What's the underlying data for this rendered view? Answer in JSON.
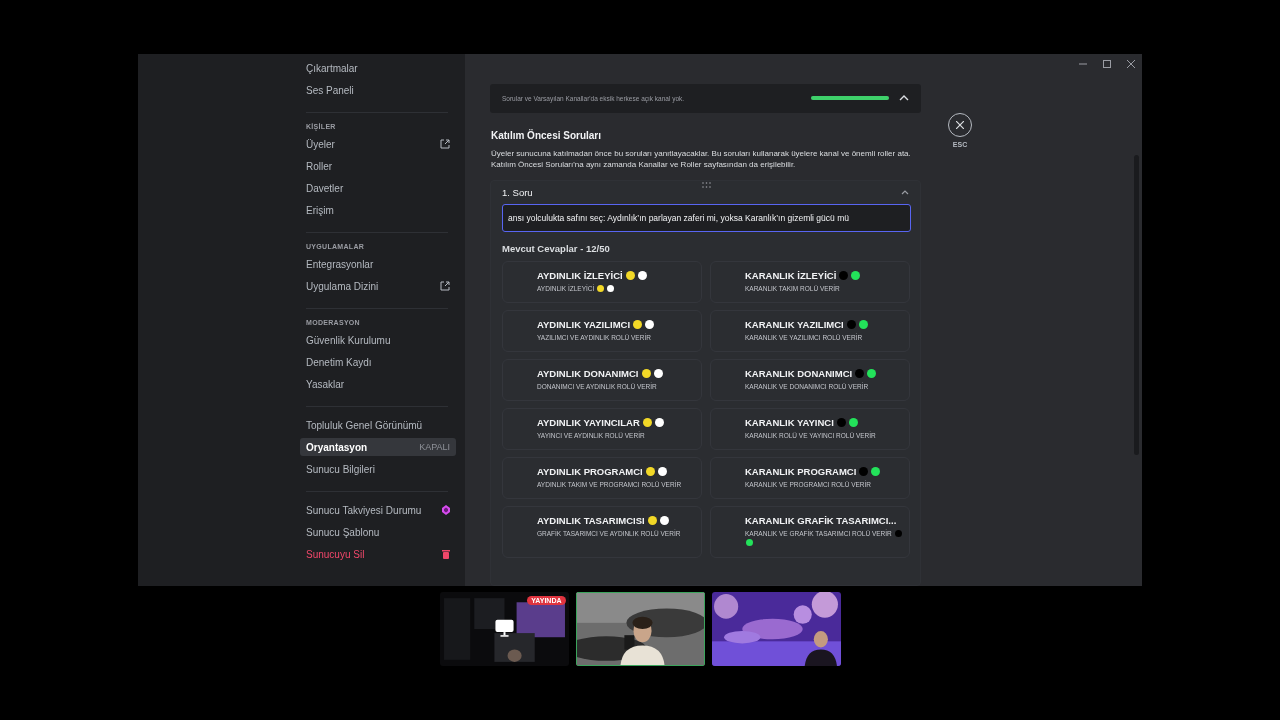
{
  "sidebar": {
    "groups": [
      {
        "items": [
          {
            "label": "Çıkartmalar",
            "selected": false,
            "kind": "plain"
          },
          {
            "label": "Ses Paneli",
            "selected": false,
            "kind": "plain"
          }
        ]
      },
      {
        "header": "KİŞİLER",
        "items": [
          {
            "label": "Üyeler",
            "selected": false,
            "kind": "external"
          },
          {
            "label": "Roller",
            "selected": false,
            "kind": "plain"
          },
          {
            "label": "Davetler",
            "selected": false,
            "kind": "plain"
          },
          {
            "label": "Erişim",
            "selected": false,
            "kind": "plain"
          }
        ]
      },
      {
        "header": "UYGULAMALAR",
        "items": [
          {
            "label": "Entegrasyonlar",
            "selected": false,
            "kind": "plain"
          },
          {
            "label": "Uygulama Dizini",
            "selected": false,
            "kind": "external"
          }
        ]
      },
      {
        "header": "MODERASYON",
        "items": [
          {
            "label": "Güvenlik Kurulumu",
            "selected": false,
            "kind": "plain"
          },
          {
            "label": "Denetim Kaydı",
            "selected": false,
            "kind": "plain"
          },
          {
            "label": "Yasaklar",
            "selected": false,
            "kind": "plain"
          }
        ]
      },
      {
        "items": [
          {
            "label": "Topluluk Genel Görünümü",
            "selected": false,
            "kind": "plain"
          },
          {
            "label": "Oryantasyon",
            "selected": true,
            "kind": "badge",
            "badge": "KAPALI"
          },
          {
            "label": "Sunucu Bilgileri",
            "selected": false,
            "kind": "plain"
          }
        ]
      },
      {
        "items": [
          {
            "label": "Sunucu Takviyesi Durumu",
            "selected": false,
            "kind": "boost"
          },
          {
            "label": "Sunucu Şablonu",
            "selected": false,
            "kind": "plain"
          },
          {
            "label": "Sunucuyu Sil",
            "selected": false,
            "kind": "danger"
          }
        ]
      }
    ]
  },
  "banner": {
    "text": "Sorular ve Varsayılan Kanallar'da eksik herkese açık kanal yok.",
    "level": 1
  },
  "close": {
    "label": "ESC"
  },
  "section": {
    "title": "Katılım Öncesi Soruları",
    "description": "Üyeler sunucuna katılmadan önce bu soruları yanıtlayacaklar. Bu soruları kullanarak üyelere kanal ve önemli roller ata. Katılım Öncesi Soruları'na aynı zamanda Kanallar ve Roller sayfasından da erişilebilir."
  },
  "question": {
    "label": "1. Soru",
    "value": "ansı yolculukta safını seç: Aydınlık’ın parlayan zaferi mi, yoksa Karanlık’ın gizemli gücü mü",
    "expanded": true,
    "answers_title": "Mevcut Cevaplar - 12/50",
    "answers": [
      {
        "title": "AYDINLIK İZLEYİCİ",
        "description": "AYDINLIK İZLEYİCİ",
        "kind": "both",
        "dots": [
          {
            "color": "#f2d827"
          },
          {
            "color": "#ffffff"
          }
        ]
      },
      {
        "title": "KARANLIK İZLEYİCİ",
        "description": "KARANLIK TAKIM ROLÜ VERİR",
        "kind": "title",
        "dots": [
          {
            "color": "#000000"
          },
          {
            "color": "#23e25a"
          }
        ]
      },
      {
        "title": "AYDINLIK YAZILIMCI",
        "description": "YAZILIMCI VE AYDINLIK ROLÜ VERİR",
        "kind": "title",
        "dots": [
          {
            "color": "#f2d827"
          },
          {
            "color": "#ffffff"
          }
        ]
      },
      {
        "title": "KARANLIK YAZILIMCI",
        "description": "KARANLIK VE YAZILIMCI ROLÜ VERİR",
        "kind": "title",
        "dots": [
          {
            "color": "#000000"
          },
          {
            "color": "#23e25a"
          }
        ]
      },
      {
        "title": "AYDINLIK DONANIMCI",
        "description": "DONANIMCI VE AYDINLIK ROLÜ VERİR",
        "kind": "title",
        "dots": [
          {
            "color": "#f2d827"
          },
          {
            "color": "#ffffff"
          }
        ]
      },
      {
        "title": "KARANLIK DONANIMCI",
        "description": "KARANLIK VE DONANIMCI ROLÜ VERİR",
        "kind": "title",
        "dots": [
          {
            "color": "#000000"
          },
          {
            "color": "#23e25a"
          }
        ]
      },
      {
        "title": "AYDINLIK YAYINCILAR",
        "description": "YAYINCI VE AYDINLIK ROLÜ VERİR",
        "kind": "title",
        "dots": [
          {
            "color": "#f2d827"
          },
          {
            "color": "#ffffff"
          }
        ]
      },
      {
        "title": "KARANLIK YAYINCI",
        "description": "KARANLIK ROLÜ VE YAYINCI ROLÜ VERİR",
        "kind": "title",
        "dots": [
          {
            "color": "#000000"
          },
          {
            "color": "#23e25a"
          }
        ]
      },
      {
        "title": "AYDINLIK PROGRAMCI",
        "description": "AYDINLIK TAKIM VE PROGRAMCI ROLÜ VERİR",
        "kind": "title",
        "dots": [
          {
            "color": "#f2d827"
          },
          {
            "color": "#ffffff"
          }
        ]
      },
      {
        "title": "KARANLIK PROGRAMCI",
        "description": "KARANLIK VE PROGRAMCI ROLÜ VERİR",
        "kind": "title",
        "dots": [
          {
            "color": "#000000"
          },
          {
            "color": "#23e25a"
          }
        ]
      },
      {
        "title": "AYDINLIK TASARIMCISI",
        "description": "GRAFİK TASARIMCI VE AYDINLIK ROLÜ VERİR",
        "kind": "title",
        "dots": [
          {
            "color": "#f2d827"
          },
          {
            "color": "#ffffff"
          }
        ]
      },
      {
        "title": "KARANLIK GRAFİK TASARIMCI...",
        "description": "KARANLIK VE GRAFİK TASARIMCI ROLÜ VERİR",
        "kind": "description",
        "dots": [
          {
            "color": "#000000"
          },
          {
            "color": "#23e25a"
          }
        ]
      }
    ]
  },
  "streams": [
    {
      "kind": "screen",
      "selected": false,
      "badge": "YAYINDA"
    },
    {
      "kind": "camera",
      "selected": true
    },
    {
      "kind": "game",
      "selected": false
    }
  ]
}
